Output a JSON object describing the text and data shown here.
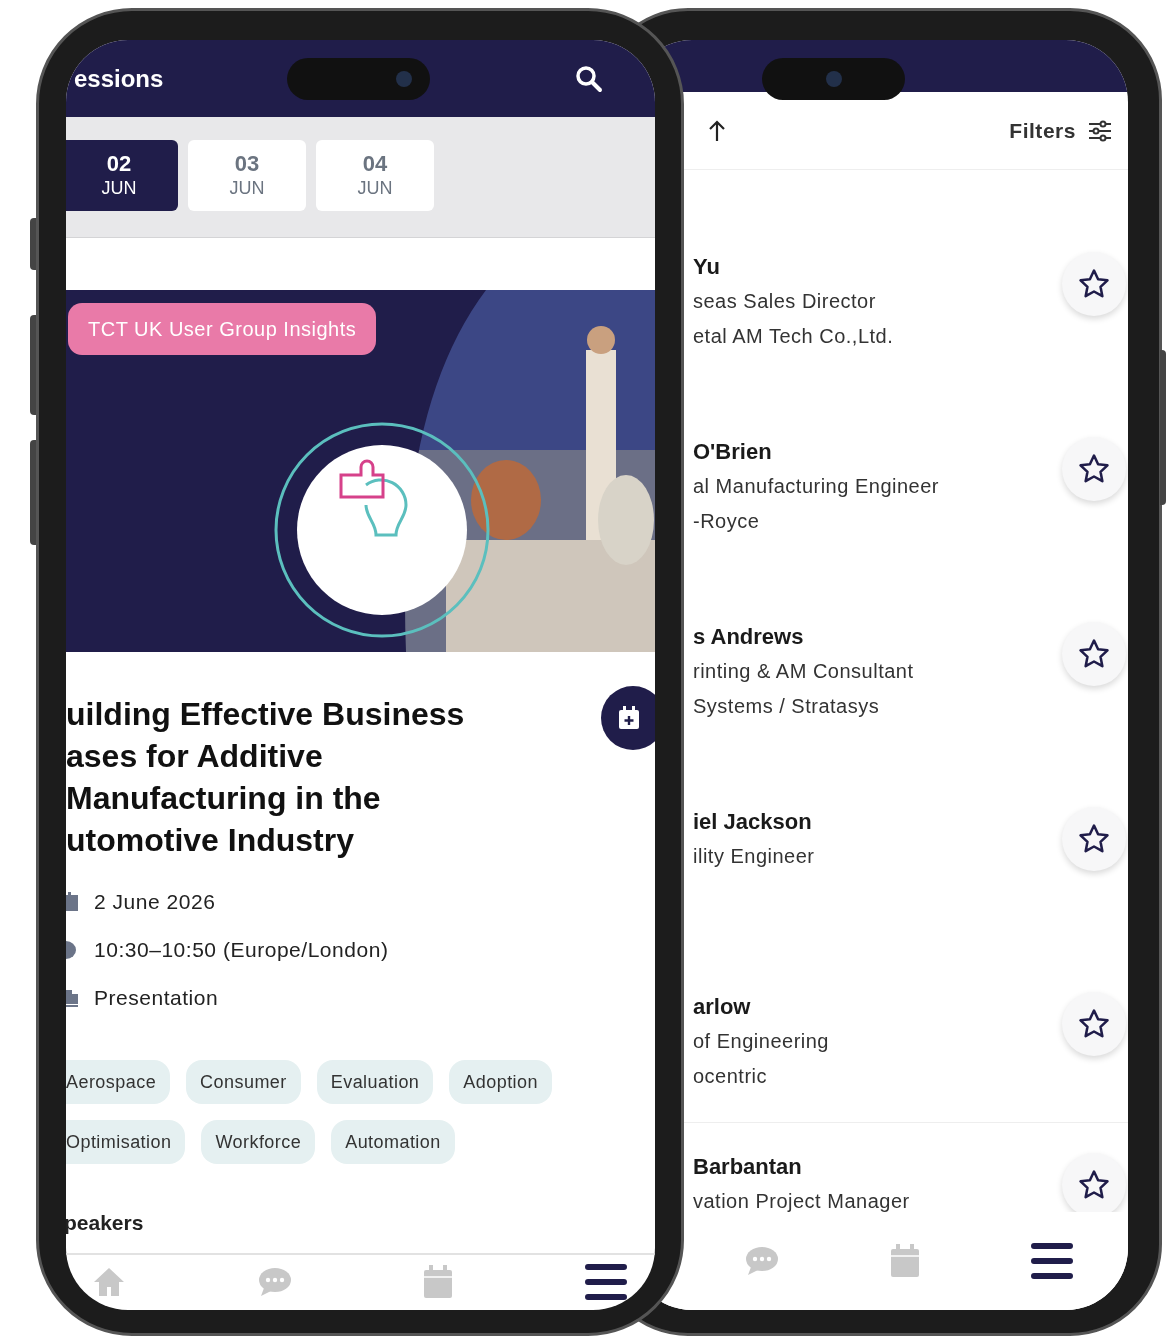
{
  "speakers_screen": {
    "filters_label": "Filters",
    "speakers": [
      {
        "name": "Yu",
        "role": "seas Sales Director",
        "company": "etal AM Tech Co.,Ltd.",
        "favorite": false
      },
      {
        "name": "O'Brien",
        "role": "al Manufacturing Engineer",
        "company": "-Royce",
        "favorite": false
      },
      {
        "name": "s Andrews",
        "role": "rinting & AM Consultant",
        "company": "Systems / Stratasys",
        "favorite": false
      },
      {
        "name": "iel Jackson",
        "role": "ility Engineer",
        "favorite": false
      },
      {
        "name": "arlow",
        "role": "of Engineering",
        "company": "ocentric",
        "favorite": false
      },
      {
        "name": "Barbantan",
        "role": "vation Project Manager",
        "favorite": false
      }
    ],
    "nav": [
      {
        "kind": "chat",
        "selected": false
      },
      {
        "kind": "calendar",
        "selected": false
      },
      {
        "kind": "menu",
        "selected": true
      }
    ]
  },
  "session_screen": {
    "title": "essions",
    "date_tabs": [
      {
        "day": "02",
        "month": "JUN",
        "selected": true
      },
      {
        "day": "03",
        "month": "JUN",
        "selected": false
      },
      {
        "day": "04",
        "month": "JUN",
        "selected": false
      }
    ],
    "badge": "TCT UK User Group Insights",
    "title_lines": [
      "uilding Effective Business",
      "ases for Additive",
      "Manufacturing in the",
      "utomotive Industry"
    ],
    "details": [
      {
        "kind": "date",
        "text": "2 June 2026"
      },
      {
        "kind": "time",
        "text": "10:30–10:50 (Europe/London)"
      },
      {
        "kind": "type",
        "text": "Presentation"
      }
    ],
    "tag_rows": [
      [
        "Aerospace",
        "Consumer",
        "Evaluation",
        "Adoption"
      ],
      [
        "Optimisation",
        "Workforce",
        "Automation"
      ]
    ],
    "section_heading": "peakers",
    "nav": [
      {
        "kind": "home",
        "selected": false
      },
      {
        "kind": "chat",
        "selected": false
      },
      {
        "kind": "calendar",
        "selected": false
      },
      {
        "kind": "menu",
        "selected": true
      }
    ]
  }
}
